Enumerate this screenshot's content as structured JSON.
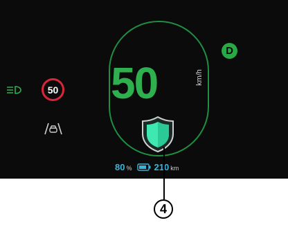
{
  "speedometer": {
    "speed": "50",
    "unit": "km/h"
  },
  "gear": "D",
  "speed_limit": "50",
  "status": {
    "battery_percent": "80",
    "percent_sign": "%",
    "range": "210",
    "range_unit": "km"
  },
  "callout": {
    "number": "4"
  },
  "icons": {
    "headlights": "headlights-icon",
    "lane": "lane-assist-icon",
    "shield": "driver-assist-shield-icon",
    "battery": "battery-icon"
  },
  "colors": {
    "background": "#0b0b0b",
    "speed_green": "#2fb04f",
    "gear_green": "#29a846",
    "limit_red": "#d8273a",
    "info_blue": "#3ab5da",
    "shield_teal": "#3ee8b0"
  }
}
